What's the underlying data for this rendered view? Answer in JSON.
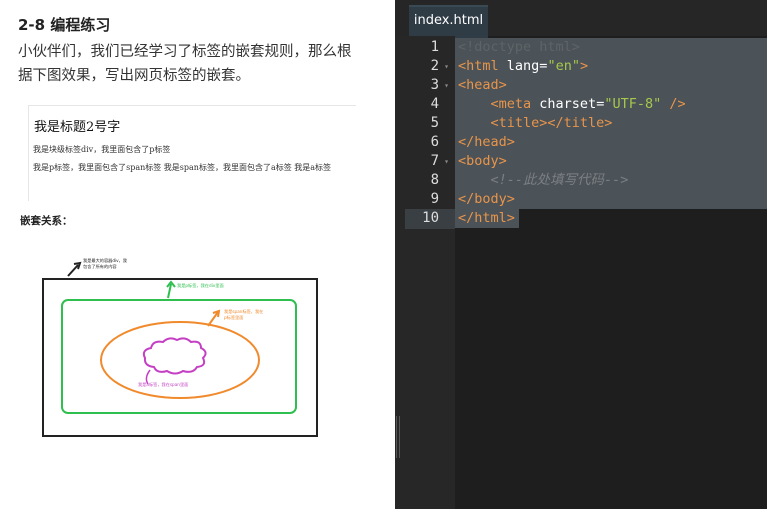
{
  "lesson": {
    "title": "2-8 编程练习",
    "description": "小伙伴们，我们已经学习了标签的嵌套规则，那么根据下图效果，写出网页标签的嵌套。"
  },
  "preview": {
    "heading": "我是标题2号字",
    "line1": "我是块级标签div，我里面包含了p标签",
    "line2": "我是p标签，我里面包含了span标签 我是span标签，我里面包含了a标签 我是a标签"
  },
  "nesting_label": "嵌套关系：",
  "diagram": {
    "outer_note": [
      "我是最大的容器div，我",
      "包含了所有的内容"
    ],
    "p_note": "我是p标签，我在div里面",
    "span_note": [
      "我是span标签，我在",
      "p标签里面"
    ],
    "a_note": "我是a标签，我在span里面",
    "colors": {
      "div": "#222222",
      "p": "#2fbf4f",
      "span": "#f08a2c",
      "a": "#c43fc4"
    }
  },
  "editor": {
    "tab_label": "index.html",
    "line_numbers": [
      "1",
      "2",
      "3",
      "4",
      "5",
      "6",
      "7",
      "8",
      "9",
      "10"
    ],
    "lines": [
      [
        "<!doctype html>"
      ],
      [
        "<html ",
        "lang",
        "=",
        "\"en\"",
        ">"
      ],
      [
        "<head>"
      ],
      [
        "    ",
        "<meta ",
        "charset",
        "=",
        "\"UTF-8\"",
        " />"
      ],
      [
        "    ",
        "<title></title>"
      ],
      [
        "</head>"
      ],
      [
        "<body>"
      ],
      [
        "    ",
        "<!--此处填写代码-->"
      ],
      [
        "</body>"
      ],
      [
        "</html>"
      ]
    ],
    "colors": {
      "tag": "#e8954a",
      "string": "#a6c84b",
      "comment": "#7b7f83",
      "background": "#1e1e1e",
      "selection": "#4b5258"
    }
  }
}
